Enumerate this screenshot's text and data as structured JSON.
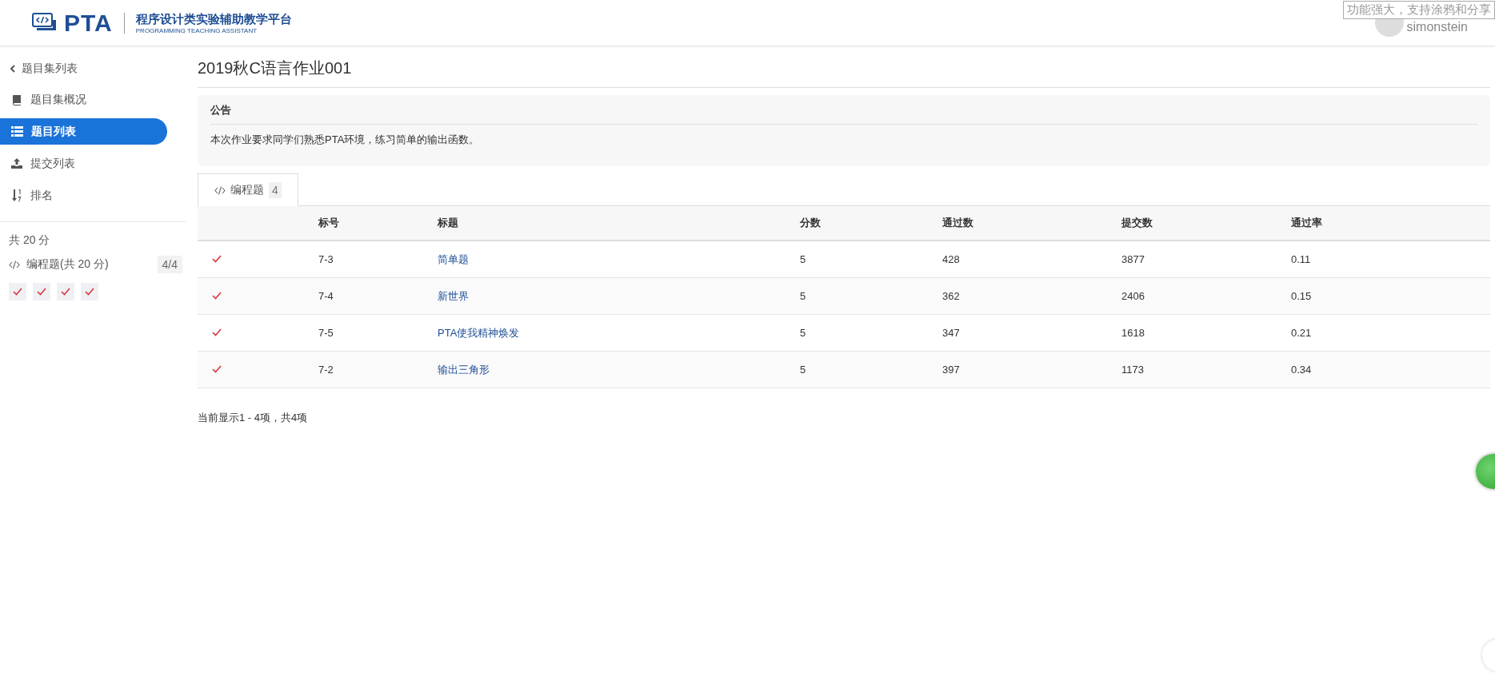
{
  "header": {
    "logo_text": "PTA",
    "subtitle": "程序设计类实验辅助教学平台",
    "tagline": "PROGRAMMING TEACHING ASSISTANT",
    "tooltip": "功能强大，支持涂鸦和分享",
    "username": "simonstein"
  },
  "sidebar": {
    "back": "题目集列表",
    "items": [
      {
        "label": "题目集概况",
        "kind": "book",
        "selected": false
      },
      {
        "label": "题目列表",
        "kind": "list",
        "selected": true
      },
      {
        "label": "提交列表",
        "kind": "upload",
        "selected": false
      },
      {
        "label": "排名",
        "kind": "sort",
        "selected": false
      }
    ],
    "total": "共 20 分",
    "sections": [
      {
        "label": "编程题(共 20 分)",
        "count": "4/4",
        "problems": [
          {
            "solved": true
          },
          {
            "solved": true
          },
          {
            "solved": true
          },
          {
            "solved": true
          }
        ]
      }
    ]
  },
  "main": {
    "title": "2019秋C语言作业001",
    "notice": {
      "title": "公告",
      "body": "本次作业要求同学们熟悉PTA环境，练习简单的输出函数。"
    },
    "tabs": [
      {
        "label": "编程题",
        "count": "4",
        "selected": true
      }
    ],
    "table": {
      "columns": [
        "标号",
        "标题",
        "分数",
        "通过数",
        "提交数",
        "通过率"
      ],
      "rows": [
        {
          "solved": true,
          "id": "7-3",
          "title": "简单题",
          "score": "5",
          "passed": "428",
          "submitted": "3877",
          "rate": "0.11"
        },
        {
          "solved": true,
          "id": "7-4",
          "title": "新世界",
          "score": "5",
          "passed": "362",
          "submitted": "2406",
          "rate": "0.15"
        },
        {
          "solved": true,
          "id": "7-5",
          "title": "PTA使我精神焕发",
          "score": "5",
          "passed": "347",
          "submitted": "1618",
          "rate": "0.21"
        },
        {
          "solved": true,
          "id": "7-2",
          "title": "输出三角形",
          "score": "5",
          "passed": "397",
          "submitted": "1173",
          "rate": "0.34"
        }
      ]
    },
    "footer": "当前显示1 - 4项，共4项"
  }
}
